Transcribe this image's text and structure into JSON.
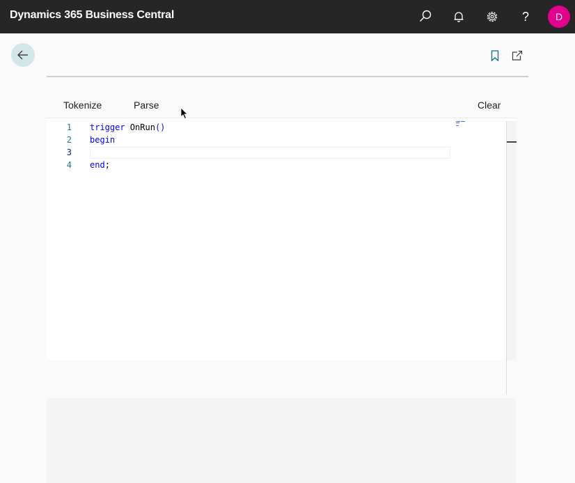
{
  "app": {
    "title": "Dynamics 365 Business Central"
  },
  "topbar": {
    "icons": [
      "search-icon",
      "bell-icon",
      "gear-icon",
      "help-icon"
    ],
    "help_glyph": "?",
    "avatar_initial": "D",
    "avatar_color": "#e3008c"
  },
  "page": {
    "back_icon": "arrow-left-icon",
    "header_icons": [
      "bookmark-icon",
      "open-in-new-window-icon"
    ]
  },
  "actions": {
    "tokenize": "Tokenize",
    "parse": "Parse",
    "clear": "Clear"
  },
  "editor": {
    "lines": [
      {
        "number": "1",
        "tokens": [
          "trigger",
          " OnRun",
          "()"
        ]
      },
      {
        "number": "2",
        "tokens": [
          "begin"
        ]
      },
      {
        "number": "3",
        "tokens": []
      },
      {
        "number": "4",
        "tokens": [
          "end",
          ";"
        ]
      }
    ],
    "active_line": "3",
    "keyword_color": "#0000ff",
    "line_number_color": "#237893"
  }
}
